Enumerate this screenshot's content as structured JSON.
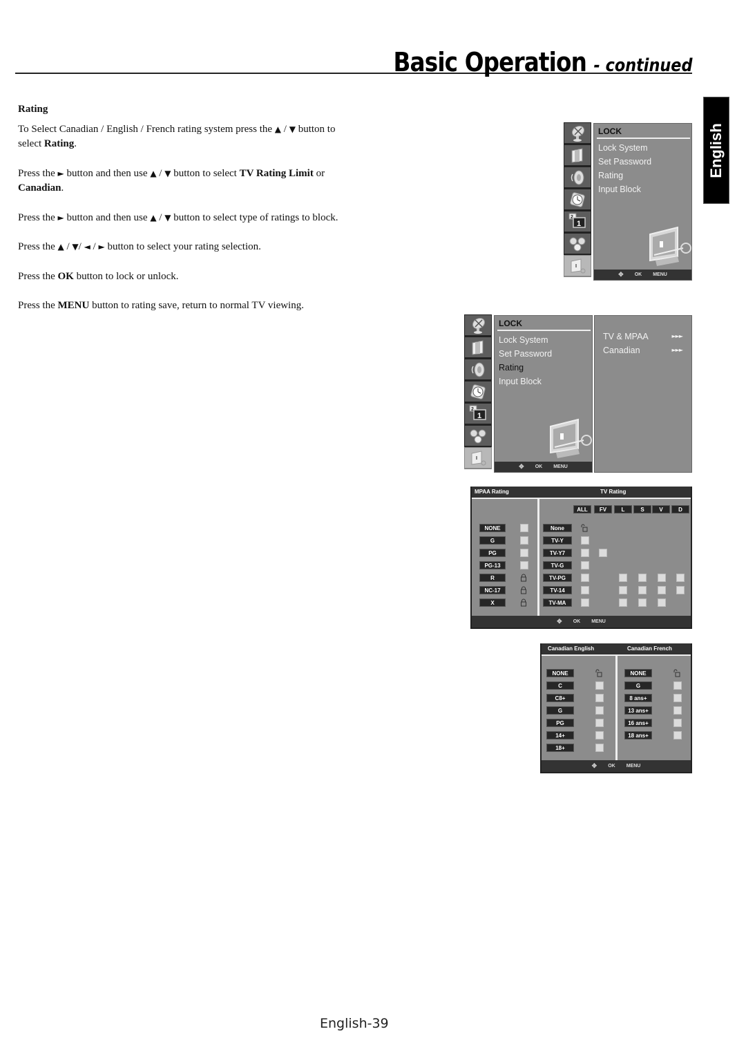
{
  "header": {
    "title": "Basic Operation",
    "suffix": "- continued"
  },
  "side_tab": {
    "label": "English"
  },
  "section": {
    "heading": "Rating",
    "paragraphs": [
      {
        "parts": [
          "To Select Canadian / English / French rating system press the ",
          "▲",
          " / ",
          "▼",
          " button to select ",
          "Rating",
          "."
        ]
      },
      {
        "parts": [
          "Press the ",
          "►",
          " button and then use ",
          "▲",
          " / ",
          "▼",
          " button to select ",
          "TV Rating Limit",
          " or ",
          "Canadian",
          "."
        ]
      },
      {
        "parts": [
          "Press the ",
          "►",
          " button and then use ",
          "▲",
          " / ",
          "▼",
          " button to select type of ratings to block."
        ]
      },
      {
        "parts": [
          "Press the ",
          "▲",
          " / ",
          "▼",
          "/ ",
          "◄",
          " / ",
          "►",
          " button to select your rating selection."
        ]
      },
      {
        "parts": [
          "Press the ",
          "OK",
          " button to lock or unlock."
        ]
      },
      {
        "parts": [
          "Press the ",
          "MENU",
          " button to rating save, return to normal TV viewing."
        ]
      }
    ]
  },
  "osd_menu": {
    "title": "LOCK",
    "items": [
      "Lock System",
      "Set Password",
      "Rating",
      "Input Block"
    ],
    "selected_index_second_screen": 2,
    "sidebar_icons": [
      "satellite-dish-icon",
      "picture-icon",
      "speaker-icon",
      "clock-icon",
      "pip-icon",
      "settings-gears-icon",
      "lock-tv-icon"
    ],
    "footer": {
      "nav": "✥",
      "ok": "OK",
      "menu": "MENU"
    },
    "submenu": [
      {
        "label": "TV & MPAA",
        "arrows": "►►►"
      },
      {
        "label": "Canadian",
        "arrows": "►►►"
      }
    ]
  },
  "tv_mpaa_panel": {
    "mpaa_header": "MPAA Rating",
    "tv_header": "TV Rating",
    "mpaa_ratings": [
      {
        "label": "NONE",
        "state": "unchecked"
      },
      {
        "label": "G",
        "state": "unchecked"
      },
      {
        "label": "PG",
        "state": "unchecked"
      },
      {
        "label": "PG-13",
        "state": "unchecked"
      },
      {
        "label": "R",
        "state": "locked"
      },
      {
        "label": "NC-17",
        "state": "locked"
      },
      {
        "label": "X",
        "state": "locked"
      }
    ],
    "tv_columns": [
      "ALL",
      "FV",
      "L",
      "S",
      "V",
      "D"
    ],
    "tv_ratings": [
      {
        "label": "None",
        "cells": [
          "unlocked",
          null,
          null,
          null,
          null,
          null
        ]
      },
      {
        "label": "TV-Y",
        "cells": [
          "box",
          null,
          null,
          null,
          null,
          null
        ]
      },
      {
        "label": "TV-Y7",
        "cells": [
          "box",
          "box",
          null,
          null,
          null,
          null
        ]
      },
      {
        "label": "TV-G",
        "cells": [
          "box",
          null,
          null,
          null,
          null,
          null
        ]
      },
      {
        "label": "TV-PG",
        "cells": [
          "box",
          null,
          "box",
          "box",
          "box",
          "box"
        ]
      },
      {
        "label": "TV-14",
        "cells": [
          "box",
          null,
          "box",
          "box",
          "box",
          "box"
        ]
      },
      {
        "label": "TV-MA",
        "cells": [
          "box",
          null,
          "box",
          "box",
          "box",
          null
        ]
      }
    ],
    "footer": {
      "nav": "✥",
      "ok": "OK",
      "menu": "MENU"
    }
  },
  "canadian_panel": {
    "english_header": "Canadian English",
    "french_header": "Canadian French",
    "english_ratings": [
      {
        "label": "NONE",
        "state": "unlocked"
      },
      {
        "label": "C",
        "state": "box"
      },
      {
        "label": "C8+",
        "state": "box"
      },
      {
        "label": "G",
        "state": "box"
      },
      {
        "label": "PG",
        "state": "box"
      },
      {
        "label": "14+",
        "state": "box"
      },
      {
        "label": "18+",
        "state": "box"
      }
    ],
    "french_ratings": [
      {
        "label": "NONE",
        "state": "unlocked"
      },
      {
        "label": "G",
        "state": "box"
      },
      {
        "label": "8 ans+",
        "state": "box"
      },
      {
        "label": "13 ans+",
        "state": "box"
      },
      {
        "label": "16 ans+",
        "state": "box"
      },
      {
        "label": "18 ans+",
        "state": "box"
      }
    ],
    "footer": {
      "nav": "✥",
      "ok": "OK",
      "menu": "MENU"
    }
  },
  "page_number": "English-39",
  "colors": {
    "osd_gray": "#8c8c8c",
    "osd_dark": "#333333",
    "tag_bg": "#262626",
    "checkbox": "#dcdcdc",
    "tab_black": "#000000"
  }
}
